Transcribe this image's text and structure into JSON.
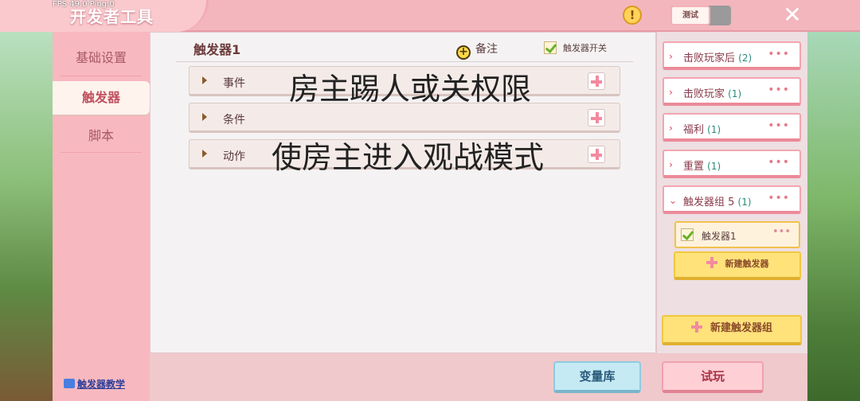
{
  "status": {
    "fps_text": "FPS 49.0  Ping:0"
  },
  "app": {
    "title": "开发者工具"
  },
  "topbar": {
    "test_label": "测试",
    "warn_symbol": "!",
    "close_symbol": "✕"
  },
  "sidebar": {
    "items": [
      {
        "label": "基础设置",
        "active": false
      },
      {
        "label": "触发器",
        "active": true
      },
      {
        "label": "脚本",
        "active": false
      }
    ],
    "tutorial_label": "触发器教学"
  },
  "editor": {
    "trigger_name": "触发器1",
    "note_label": "备注",
    "switch_label": "触发器开关",
    "sections": [
      {
        "label": "事件"
      },
      {
        "label": "条件"
      },
      {
        "label": "动作"
      }
    ],
    "overlay_text_1": "房主踢人或关权限",
    "overlay_text_2": "使房主进入观战模式"
  },
  "right_panel": {
    "groups": [
      {
        "name": "击败玩家后",
        "count": "(2)",
        "chevron": "›"
      },
      {
        "name": "击败玩家",
        "count": "(1)",
        "chevron": "›"
      },
      {
        "name": "福利",
        "count": "(1)",
        "chevron": "›"
      },
      {
        "name": "重置",
        "count": "(1)",
        "chevron": "›"
      },
      {
        "name": "触发器组 5",
        "count": "(1)",
        "chevron": "⌄"
      }
    ],
    "more_symbol": "•••",
    "selected_trigger": "触发器1",
    "new_trigger_label": "新建触发器",
    "new_group_label": "新建触发器组"
  },
  "bottom": {
    "variable_library_label": "变量库",
    "play_label": "试玩"
  },
  "colors": {
    "primary_pink": "#f3b6bd",
    "accent_yellow": "#ffe27a",
    "accent_blue": "#c5eaf4"
  }
}
